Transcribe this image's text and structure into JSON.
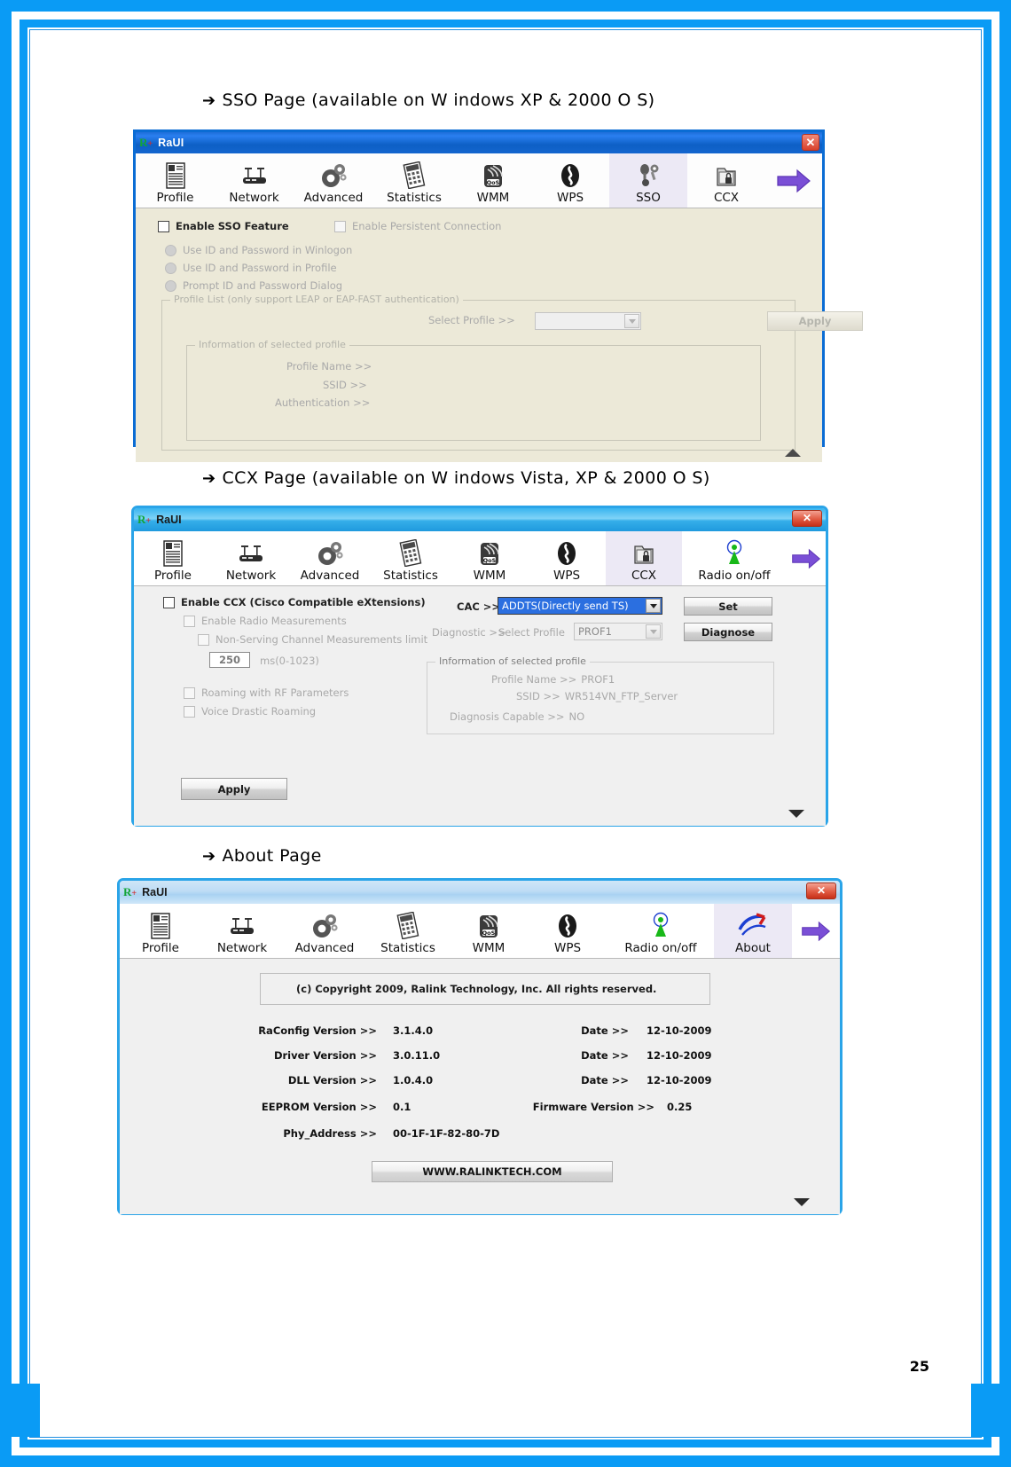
{
  "document": {
    "page_number": "25"
  },
  "sections": [
    {
      "arrow": "➔",
      "title": "SSO  Page (available on W indows XP & 2000 O S)"
    },
    {
      "arrow": "➔",
      "title": "CCX Page (available on W indows Vista, XP & 2000 O S)"
    },
    {
      "arrow": "➔",
      "title": "About Page"
    }
  ],
  "sso_window": {
    "title": "RaUI",
    "close_label": "✕",
    "tabs": [
      {
        "label": "Profile",
        "icon": "profile-icon",
        "active": false
      },
      {
        "label": "Network",
        "icon": "network-icon",
        "active": false
      },
      {
        "label": "Advanced",
        "icon": "advanced-icon",
        "active": false
      },
      {
        "label": "Statistics",
        "icon": "statistics-icon",
        "active": false
      },
      {
        "label": "WMM",
        "icon": "wmm-qos-icon",
        "active": false
      },
      {
        "label": "WPS",
        "icon": "wps-icon",
        "active": false
      },
      {
        "label": "SSO",
        "icon": "sso-icon",
        "active": true
      },
      {
        "label": "CCX",
        "icon": "ccx-icon",
        "active": false
      }
    ],
    "next_arrow_icon": "next-arrow-icon",
    "enable_sso": "Enable SSO Feature",
    "enable_persistent": "Enable Persistent Connection",
    "radio_options": [
      "Use ID and Password in Winlogon",
      "Use ID and Password in Profile",
      "Prompt ID and Password Dialog"
    ],
    "profile_list_group": "Profile List (only support LEAP or EAP-FAST authentication)",
    "select_profile_label": "Select Profile >>",
    "select_profile_value": "",
    "apply_label": "Apply",
    "info_group": "Information of selected profile",
    "info_rows": [
      {
        "label": "Profile Name >>",
        "value": ""
      },
      {
        "label": "SSID >>",
        "value": ""
      },
      {
        "label": "Authentication >>",
        "value": ""
      }
    ],
    "scroll_icon": "scroll-up-arrow-icon"
  },
  "ccx_window": {
    "title": "RaUI",
    "close_label": "✕",
    "tabs": [
      {
        "label": "Profile",
        "icon": "profile-icon",
        "active": false
      },
      {
        "label": "Network",
        "icon": "network-icon",
        "active": false
      },
      {
        "label": "Advanced",
        "icon": "advanced-icon",
        "active": false
      },
      {
        "label": "Statistics",
        "icon": "statistics-icon",
        "active": false
      },
      {
        "label": "WMM",
        "icon": "wmm-qos-icon",
        "active": false
      },
      {
        "label": "WPS",
        "icon": "wps-icon",
        "active": false
      },
      {
        "label": "CCX",
        "icon": "ccx-icon",
        "active": true
      },
      {
        "label": "Radio on/off",
        "icon": "radio-onoff-icon",
        "active": false
      }
    ],
    "next_arrow_icon": "next-arrow-icon",
    "enable_ccx": "Enable CCX (Cisco Compatible eXtensions)",
    "enable_radio_measurements": "Enable Radio Measurements",
    "non_serving_limit": "Non-Serving Channel Measurements limit",
    "limit_value": "250",
    "limit_unit": "ms(0-1023)",
    "roaming_rf": "Roaming with RF Parameters",
    "voice_drastic": "Voice Drastic Roaming",
    "cac_label": "CAC >>",
    "cac_value": "ADDTS(Directly send TS)",
    "set_label": "Set",
    "diagnostic_label": "Diagnostic >>",
    "select_profile_label": "Select Profile",
    "select_profile_value": "PROF1",
    "diagnose_label": "Diagnose",
    "info_group": "Information of selected profile",
    "info_rows": [
      {
        "label": "Profile Name >>",
        "value": "PROF1"
      },
      {
        "label": "SSID >>",
        "value": "WR514VN_FTP_Server"
      },
      {
        "label": "Diagnosis Capable >>",
        "value": "NO"
      }
    ],
    "apply_label": "Apply",
    "scroll_icon": "scroll-down-arrow-icon"
  },
  "about_window": {
    "title": "RaUI",
    "close_label": "✕",
    "tabs": [
      {
        "label": "Profile",
        "icon": "profile-icon",
        "active": false
      },
      {
        "label": "Network",
        "icon": "network-icon",
        "active": false
      },
      {
        "label": "Advanced",
        "icon": "advanced-icon",
        "active": false
      },
      {
        "label": "Statistics",
        "icon": "statistics-icon",
        "active": false
      },
      {
        "label": "WMM",
        "icon": "wmm-qos-icon",
        "active": false
      },
      {
        "label": "WPS",
        "icon": "wps-icon",
        "active": false
      },
      {
        "label": "Radio on/off",
        "icon": "radio-onoff-icon",
        "active": false
      },
      {
        "label": "About",
        "icon": "about-icon",
        "active": true
      }
    ],
    "next_arrow_icon": "next-arrow-icon",
    "copyright": "(c) Copyright 2009, Ralink Technology, Inc.  All rights reserved.",
    "info_rows": [
      {
        "label": "RaConfig Version >>",
        "value": "3.1.4.0",
        "label2": "Date >>",
        "value2": "12-10-2009"
      },
      {
        "label": "Driver Version >>",
        "value": "3.0.11.0",
        "label2": "Date >>",
        "value2": "12-10-2009"
      },
      {
        "label": "DLL Version >>",
        "value": "1.0.4.0",
        "label2": "Date >>",
        "value2": "12-10-2009"
      },
      {
        "label": "EEPROM Version >>",
        "value": "0.1",
        "label2": "Firmware Version >>",
        "value2": "0.25"
      },
      {
        "label": "Phy_Address >>",
        "value": "00-1F-1F-82-80-7D",
        "label2": "",
        "value2": ""
      }
    ],
    "website": "WWW.RALINKTECH.COM",
    "scroll_icon": "scroll-down-arrow-icon"
  }
}
